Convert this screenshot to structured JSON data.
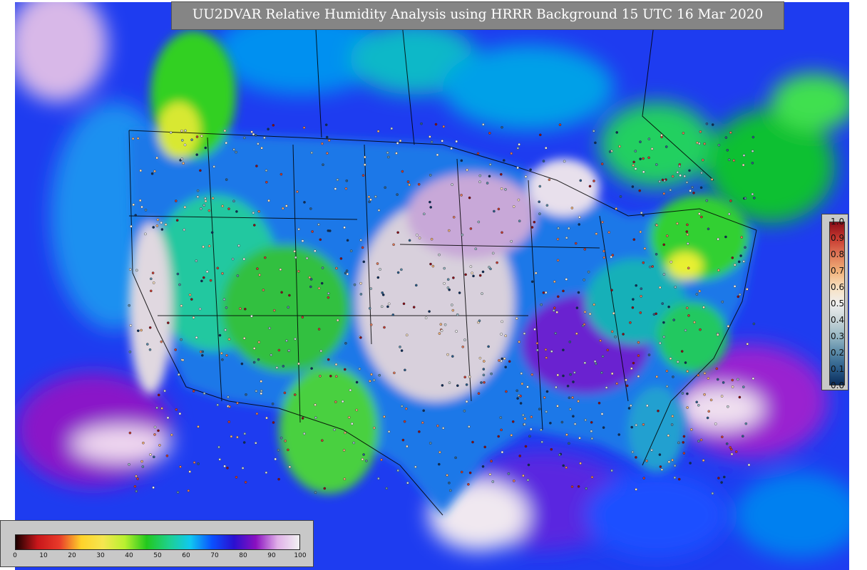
{
  "title": "UU2DVAR Relative Humidity Analysis using HRRR Background 15 UTC 16 Mar 2020",
  "map": {
    "region": "CONUS",
    "field": "relative humidity analysis",
    "observations": "station observations plotted as circles"
  },
  "rh_colorbar": {
    "ticks": [
      "0",
      "10",
      "20",
      "30",
      "40",
      "50",
      "60",
      "70",
      "80",
      "90",
      "100"
    ],
    "colors": [
      "#1a0000",
      "#c8161a",
      "#e83a2a",
      "#ffd22a",
      "#f5e650",
      "#b8f030",
      "#22c81e",
      "#1ed08c",
      "#10c8f0",
      "#0a50ff",
      "#2a10d0",
      "#8a10c0",
      "#e0b0e8",
      "#f2f2f2"
    ]
  },
  "obs_colorbar": {
    "ticks": [
      "0.0",
      "0.1",
      "0.2",
      "0.3",
      "0.4",
      "0.5",
      "0.6",
      "0.7",
      "0.8",
      "0.9",
      "1.0"
    ],
    "colors": [
      "#0a2c5a",
      "#2a5c8a",
      "#5a8aa8",
      "#98b8c4",
      "#c8d4d8",
      "#efefef",
      "#f8e0c0",
      "#f0b078",
      "#e07858",
      "#c83a30",
      "#8a0c18"
    ]
  }
}
